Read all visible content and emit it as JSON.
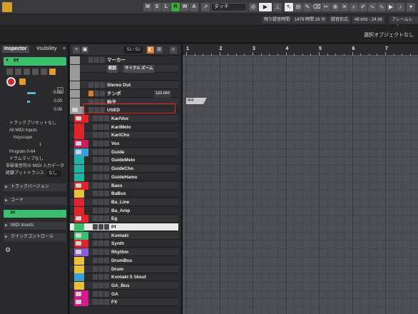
{
  "toolbar": {
    "modes": [
      "M",
      "S",
      "L",
      "R",
      "W",
      "A"
    ],
    "active_mode": "R",
    "quantize_select": "タッチ",
    "tools": [
      "pointer",
      "range",
      "pencil",
      "eraser",
      "scissors",
      "glue",
      "mute",
      "zoom",
      "draw",
      "line",
      "play",
      "speaker"
    ]
  },
  "statusbar": {
    "remaining_label": "残り録音時間",
    "remaining_value": "1479 時間 18 分",
    "format_label": "録音形式",
    "format_value": "48 kHz - 24 bit",
    "frame_label": "フレームレート"
  },
  "infoline": {
    "selected_object": "選択オブジェクトなし"
  },
  "inspector": {
    "tabs": [
      "Inspector",
      "Visibility"
    ],
    "track_name": "Pf",
    "volume": "-5.00",
    "pan": "0.00",
    "delay": "0.00",
    "track_preset": "トラックプリセットなし",
    "midi_inputs": "All MIDI Inputs",
    "output": "Keyscape",
    "channel": "1",
    "program": "Program 0-64",
    "drum_map": "ドラムマップなし",
    "nondestructive": "非破壊音符の MIDI 入力データ記録",
    "transpose_label": "インプットトランス",
    "transpose_value": "なし",
    "sections": [
      "トラックバージョン",
      "コード"
    ],
    "green_section": "Pf",
    "midi_inserts": "MIDI Inserts",
    "quick_controls": "クイックコントロール"
  },
  "tracklist": {
    "count": "51 / 52",
    "tracks": [
      {
        "name": "マーカー",
        "color": "#9a9a9a",
        "type": "marker"
      },
      {
        "name": "",
        "color": "#9a9a9a",
        "type": "marker-sub",
        "sub": [
          "範囲",
          "サイクル",
          "ズーム"
        ]
      },
      {
        "name": "",
        "color": "#9a9a9a",
        "type": "blank"
      },
      {
        "name": "Stereo Out",
        "color": "#9a9a9a",
        "type": "output"
      },
      {
        "name": "テンポ",
        "color": "#9a9a9a",
        "type": "tempo",
        "value": "120.000"
      },
      {
        "name": "拍子",
        "color": "#9a9a9a",
        "type": "signature"
      },
      {
        "name": "USED",
        "color": "#9a9a9a",
        "type": "folder"
      },
      {
        "name": "KariVox",
        "color": "#e0242c",
        "type": "folder"
      },
      {
        "name": "KariMelo",
        "color": "#e0242c",
        "type": "audio"
      },
      {
        "name": "KariCho",
        "color": "#e0242c",
        "type": "audio"
      },
      {
        "name": "Vox",
        "color": "#d11c5a",
        "type": "folder"
      },
      {
        "name": "Guide",
        "color": "#3a9fd6",
        "type": "folder"
      },
      {
        "name": "GuideMelo",
        "color": "#1fb3a0",
        "type": "midi"
      },
      {
        "name": "GuideCho",
        "color": "#1fb3a0",
        "type": "midi"
      },
      {
        "name": "GuideHamo",
        "color": "#1fb3a0",
        "type": "midi"
      },
      {
        "name": "Bass",
        "color": "#e0242c",
        "type": "folder"
      },
      {
        "name": "BaBus",
        "color": "#e8c33a",
        "type": "instrument"
      },
      {
        "name": "Ba_Line",
        "color": "#e0242c",
        "type": "audio"
      },
      {
        "name": "Ba_Amp",
        "color": "#e0242c",
        "type": "audio"
      },
      {
        "name": "Eg",
        "color": "#e0242c",
        "type": "folder"
      },
      {
        "name": "Pf",
        "color": "#3bbf6f",
        "type": "midi"
      },
      {
        "name": "Kontakt",
        "color": "#3bbf6f",
        "type": "folder"
      },
      {
        "name": "Synth",
        "color": "#e0242c",
        "type": "folder"
      },
      {
        "name": "Rhythm",
        "color": "#8c5fd0",
        "type": "folder"
      },
      {
        "name": "DrumBus",
        "color": "#e8c33a",
        "type": "instrument"
      },
      {
        "name": "Drum",
        "color": "#e8c33a",
        "type": "instrument"
      },
      {
        "name": "Kontakt 5 16out",
        "color": "#3a9fd6",
        "type": "instrument"
      },
      {
        "name": "GA_Bus",
        "color": "#e8c33a",
        "type": "instrument"
      },
      {
        "name": "GA",
        "color": "#d11c8a",
        "type": "folder"
      },
      {
        "name": "FX",
        "color": "#d11c8a",
        "type": "folder"
      }
    ]
  },
  "ruler": {
    "bars": [
      "1",
      "2",
      "3",
      "4",
      "5",
      "6",
      "7"
    ]
  },
  "project": {
    "signature_marker": "4/4"
  }
}
